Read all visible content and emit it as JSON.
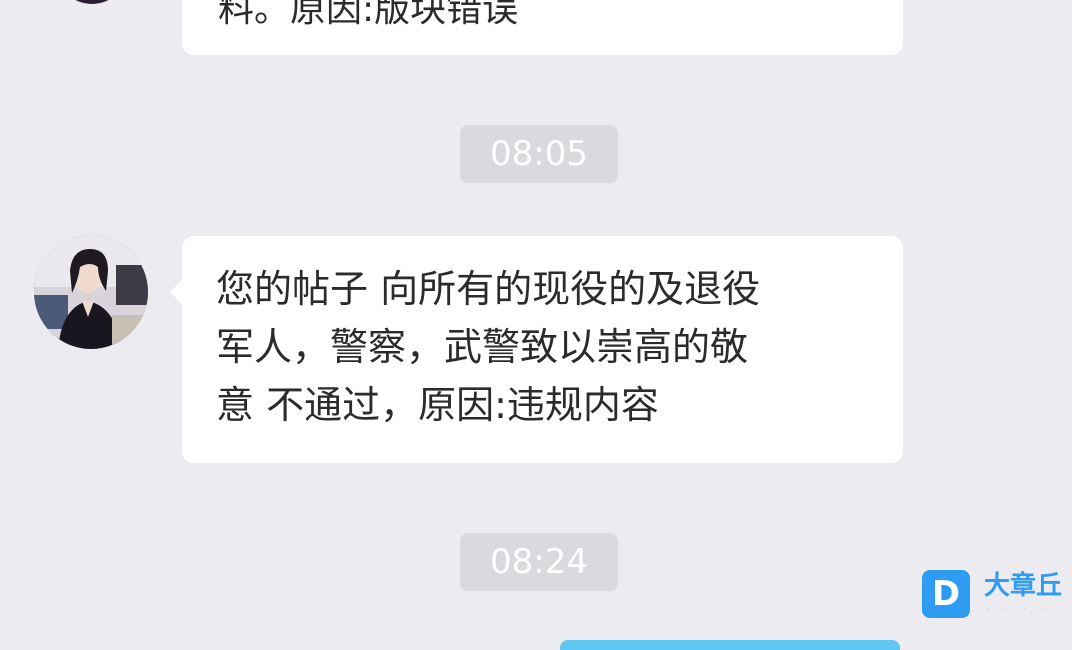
{
  "conversation": {
    "messages": [
      {
        "kind": "partial",
        "lines": [
          "料。原因:版块错误"
        ]
      },
      {
        "kind": "full",
        "lines": [
          "您的帖子 向所有的现役的及退役",
          "军人，警察，武警致以崇高的敬",
          "意 不通过，原因:违规内容"
        ]
      }
    ],
    "timestamps": [
      "08:05",
      "08:24"
    ]
  },
  "watermark": {
    "logo_letter": "D",
    "name": "大章丘",
    "colors": {
      "brand": "#2e9cf2"
    }
  },
  "colors": {
    "background": "#ebebf0",
    "bubble": "#ffffff",
    "time_pill": "#dadade",
    "own_bubble": "#5fc8f2"
  }
}
